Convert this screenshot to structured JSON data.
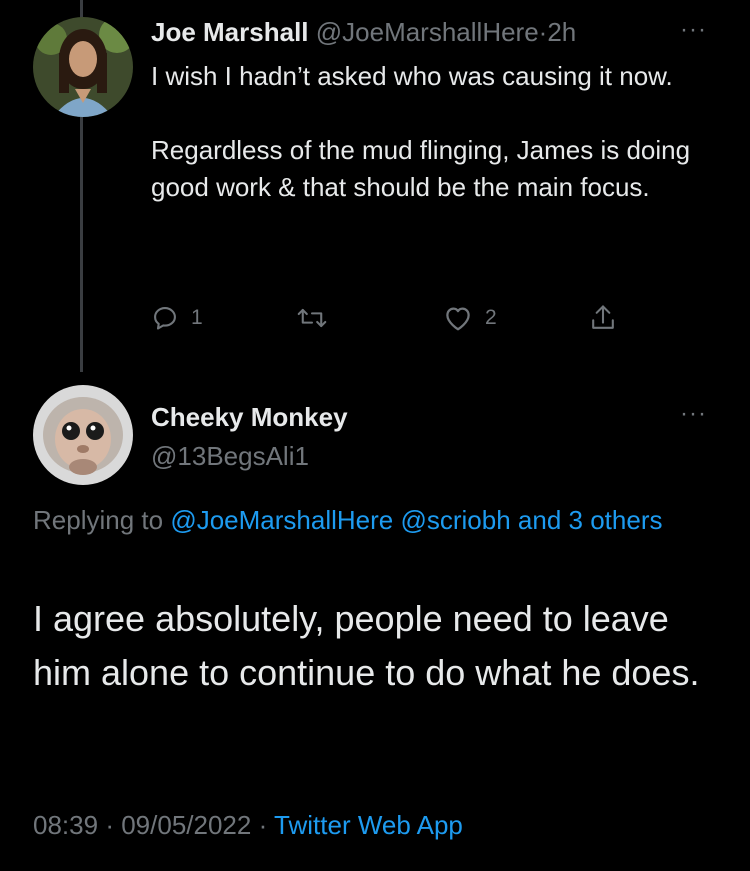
{
  "tweet_parent": {
    "name": "Joe Marshall",
    "handle": "@JoeMarshallHere",
    "separator": "·",
    "time": "2h",
    "more": "···",
    "paragraphs": [
      "I wish I hadn’t asked who was causing it now.",
      "Regardless of the mud flinging, James is doing good work & that should be the main focus."
    ],
    "actions": {
      "reply_count": "1",
      "retweet_count": "",
      "like_count": "2"
    }
  },
  "tweet_main": {
    "name": "Cheeky Monkey",
    "handle": "@13BegsAli1",
    "more": "···",
    "replying": {
      "prefix": "Replying to",
      "mention1": "@JoeMarshallHere",
      "mention2": "@scriobh",
      "others": "and 3 others"
    },
    "text": "I agree absolutely, people need to leave him alone to continue to do what he does.",
    "meta": {
      "time": "08:39",
      "dot": "·",
      "date": "09/05/2022",
      "source": "Twitter Web App"
    }
  },
  "colors": {
    "background": "#000000",
    "text": "#e7e9ea",
    "muted": "#71767b",
    "link": "#1d9bf0",
    "thread_line": "#3a3d41"
  }
}
